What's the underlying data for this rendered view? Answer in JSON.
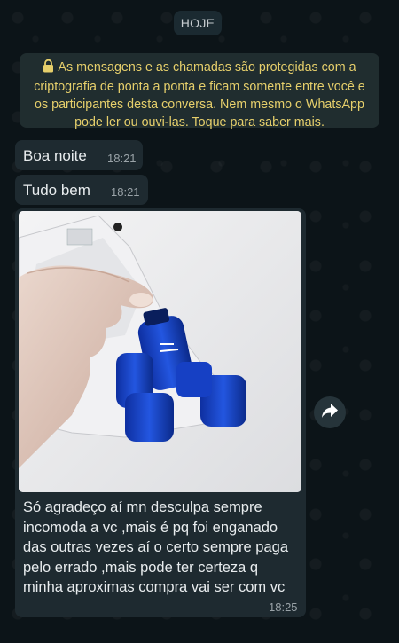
{
  "date_chip": "HOJE",
  "encryption_notice": "As mensagens e as chamadas são protegidas com a criptografia de ponta a ponta e ficam somente entre você e os participantes desta conversa. Nem mesmo o WhatsApp pode ler ou ouvi-las. Toque para saber mais.",
  "messages": [
    {
      "text": "Boa noite",
      "time": "18:21"
    },
    {
      "text": "Tudo bem",
      "time": "18:21"
    },
    {
      "text": "Só agradeço aí mn desculpa sempre incomoda a vc ,mais é pq foi enganado das outras vezes aí o certo sempre paga pelo errado ,mais pode ter certeza q minha aproximas compra vai ser com vc",
      "time": "18:25"
    }
  ],
  "icons": {
    "lock": "lock-icon",
    "forward": "forward-icon"
  },
  "colors": {
    "background": "#0c1418",
    "bubble": "#1e2a30",
    "notice_text": "#e6cf6b"
  }
}
